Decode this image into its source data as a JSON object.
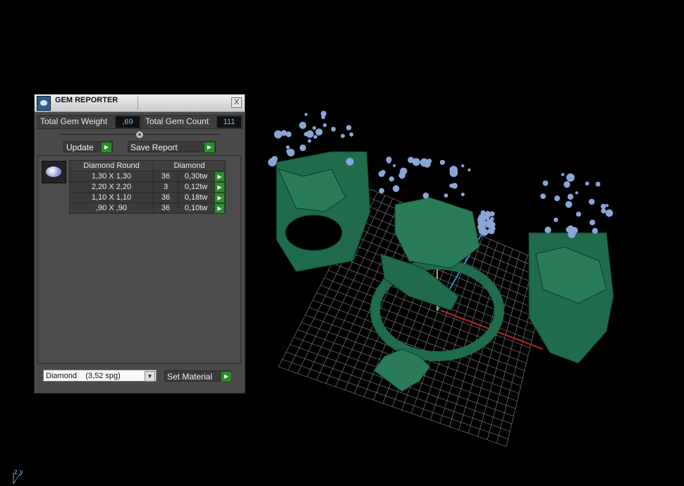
{
  "panel": {
    "title": "GEM REPORTER",
    "close_label": "X",
    "total_weight_label": "Total Gem Weight",
    "total_weight_value": ",69",
    "total_count_label": "Total Gem Count",
    "total_count_value": "111",
    "update_label": "Update",
    "save_report_label": "Save Report",
    "table": {
      "headers": [
        "Diamond Round",
        "Diamond"
      ],
      "rows": [
        {
          "size": "1,30 X 1,30",
          "count": "36",
          "weight": "0,30tw"
        },
        {
          "size": "2,20 X 2,20",
          "count": "3",
          "weight": "0,12tw"
        },
        {
          "size": "1,10 X 1,10",
          "count": "36",
          "weight": "0,18tw"
        },
        {
          "size": ",90 X ,90",
          "count": "36",
          "weight": "0,10tw"
        }
      ]
    },
    "material_value": "Diamond    (3,52 spg)",
    "set_material_label": "Set Material"
  },
  "viewport": {
    "axis_label": "z y"
  },
  "colors": {
    "model": "#1f6b4c",
    "gems": "#8aa6d6",
    "background": "#000000",
    "accent_green": "#2e8b2e"
  },
  "icons": [
    "app-icon",
    "close-icon",
    "slider-knob-icon",
    "go-arrow-icon",
    "dropdown-arrow-icon",
    "gem-thumbnail-icon"
  ]
}
